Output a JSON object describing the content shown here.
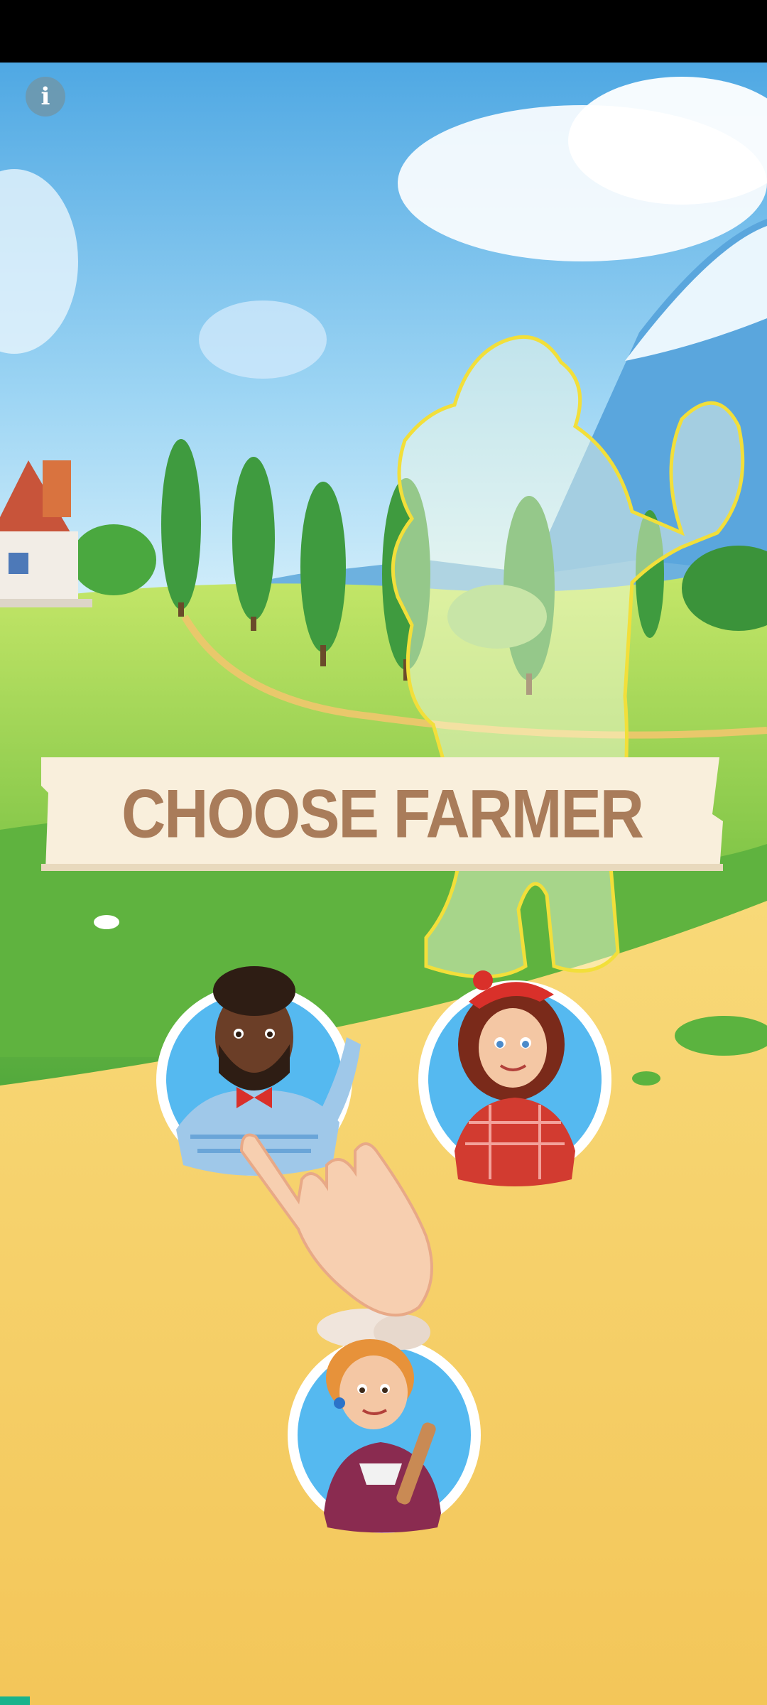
{
  "screen": {
    "title": "CHOOSE FARMER",
    "info_label": "i"
  },
  "farmers": [
    {
      "name_icon": "farmer-man-bowtie-icon",
      "selected": false
    },
    {
      "name_icon": "farmer-woman-plaid-icon",
      "selected": false
    },
    {
      "name_icon": "farmer-baker-chef-icon",
      "selected": false
    }
  ],
  "tutorial": {
    "icon": "pointing-hand-icon"
  },
  "colors": {
    "sky_top": "#5fb2e6",
    "grass": "#7cc447",
    "path": "#f5cc5e",
    "banner": "#fbf1df",
    "title": "#a97c5a",
    "avatar_ring": "#55b9f0",
    "accent_strip": "#19b38c"
  }
}
